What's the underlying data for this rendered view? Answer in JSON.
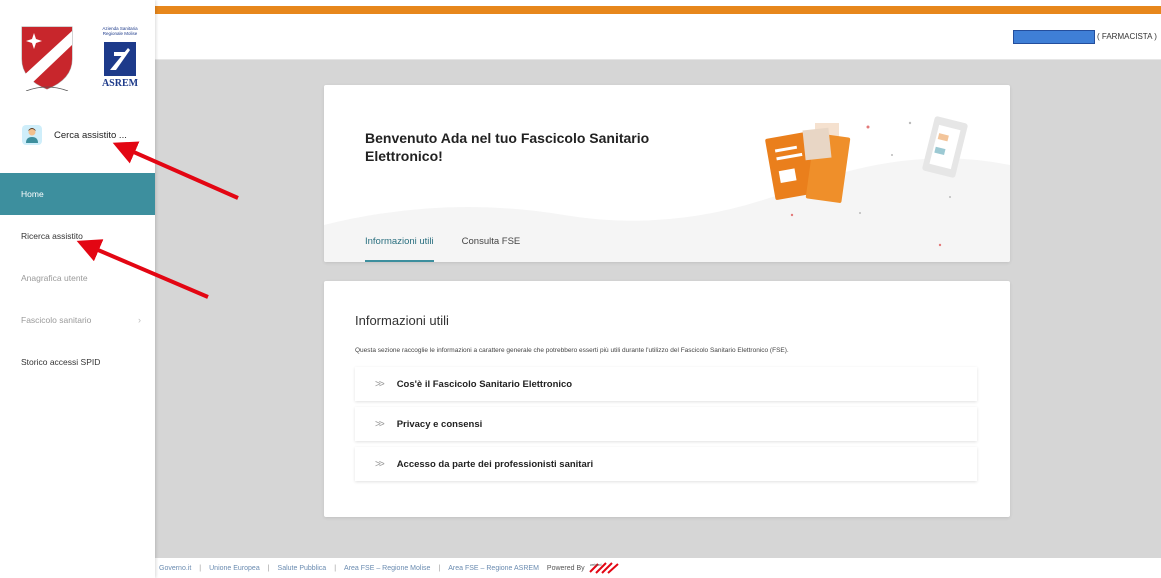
{
  "sidebar": {
    "logo_asrem_subtitle": "Azienda Sanitaria Regionale Molise",
    "logo_asrem_word": "ASREM",
    "search_label": "Cerca assistito ...",
    "items": [
      {
        "label": "Home"
      },
      {
        "label": "Ricerca assistito"
      },
      {
        "label": "Anagrafica utente"
      },
      {
        "label": "Fascicolo sanitario"
      },
      {
        "label": "Storico accessi SPID"
      }
    ]
  },
  "header": {
    "user_role": "( FARMACISTA )"
  },
  "colors": {
    "accent_orange": "#e7871c",
    "nav_active": "#3d8f9e",
    "arrow_red": "#e30613"
  },
  "welcome": {
    "title": "Benvenuto Ada nel tuo Fascicolo Sanitario Elettronico!",
    "tabs": [
      "Informazioni utili",
      "Consulta FSE"
    ]
  },
  "info": {
    "title": "Informazioni utili",
    "description": "Questa sezione raccoglie le informazioni a carattere generale che potrebbero esserti più utili durante l'utilizzo del Fascicolo Sanitario Elettronico (FSE).",
    "items": [
      "Cos'è il Fascicolo Sanitario Elettronico",
      "Privacy e consensi",
      "Accesso da parte dei professionisti sanitari"
    ]
  },
  "footer": {
    "links": [
      "Governo.it",
      "Unione Europea",
      "Salute Pubblica",
      "Area FSE – Regione Molise",
      "Area FSE – Regione ASREM"
    ],
    "powered_by": "Powered By"
  }
}
